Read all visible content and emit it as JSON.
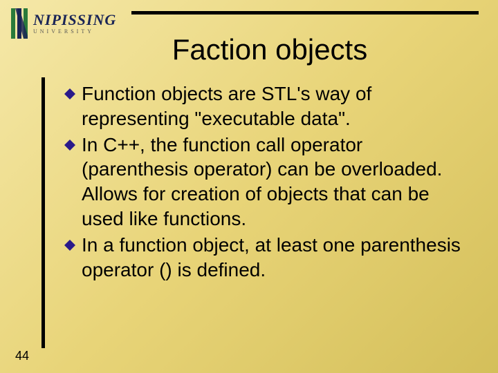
{
  "logo": {
    "name": "NIPISSING",
    "sub": "UNIVERSITY"
  },
  "title": "Faction objects",
  "bullets": [
    "Function objects are STL's way of representing \"executable data\".",
    "In C++, the function call operator (parenthesis operator) can be overloaded. Allows for creation of objects that can be used like functions.",
    "In a function object, at least one parenthesis operator () is defined."
  ],
  "page_number": "44",
  "colors": {
    "bullet_fill": "#2a1a8a"
  }
}
